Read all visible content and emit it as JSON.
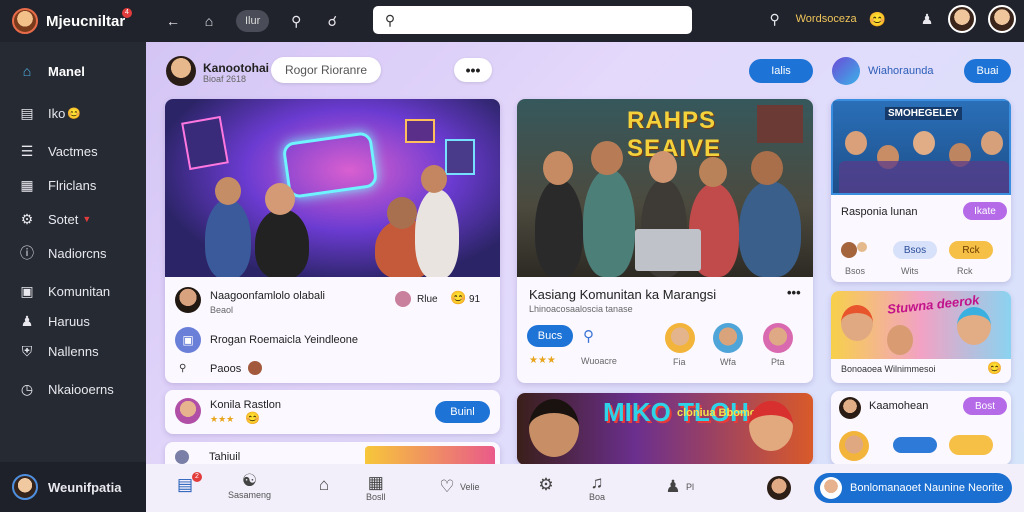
{
  "app": {
    "title": "Mjeucniltar",
    "notif_count": "4"
  },
  "nav": {
    "pill_label": "Ilur"
  },
  "search": {
    "placeholder": ""
  },
  "top_right": {
    "user_text": "Wordsoceza"
  },
  "sidebar": {
    "items": [
      {
        "label": "Manel",
        "icon": "home-icon"
      },
      {
        "label": "Iko",
        "icon": "briefcase-icon"
      },
      {
        "label": "Vactmes",
        "icon": "chart-icon"
      },
      {
        "label": "Flriclans",
        "icon": "grid-icon"
      },
      {
        "label": "Sotet",
        "icon": "settings-icon"
      },
      {
        "label": "Nadiorcns",
        "icon": "info-icon"
      },
      {
        "label": "Komunitan",
        "icon": "folder-icon"
      },
      {
        "label": "Haruus",
        "icon": "user-icon"
      },
      {
        "label": "Nallenns",
        "icon": "shield-icon"
      },
      {
        "label": "Nkaiooerns",
        "icon": "clock-icon"
      }
    ],
    "footer_label": "Weunifpatia"
  },
  "feed_header": {
    "name": "Kanootohai",
    "sub": "Bioaf 2618",
    "search_label": "Rogor Rioranre",
    "more_label": "•••",
    "right_button": "Ialis",
    "right_text": "Wiahoraunda",
    "right_button2": "Buai"
  },
  "card1": {
    "author": "Naagoonfamlolo olabali",
    "sub": "Beaol",
    "reaction_label": "Rlue",
    "reaction_count": "91",
    "line2": "Rrogan Roemaicla Yeindleone",
    "line3": "Paoos"
  },
  "card2": {
    "title": "Kasiang Komunitan ka Marangsi",
    "subtitle": "Lhinoacosaaloscia tanase",
    "banner_text": "RAHPS SEAIVE",
    "action_label": "Bucs",
    "rating": "★★★",
    "meta": "Wuoacre",
    "avatars": [
      "Fia",
      "Wfa",
      "Pta"
    ]
  },
  "card3": {
    "banner_text": "SMOHEGELEY",
    "title": "Rasponia lunan",
    "tag": "Ikate",
    "chips": [
      "Bsos",
      "Wits",
      "Rck"
    ]
  },
  "card4": {
    "banner_text": "Stuwna deerok",
    "caption": "Bonoaoea Wilnimmesoi"
  },
  "card5": {
    "name": "Konila Rastlon",
    "button": "Buinl",
    "rating": "★★★"
  },
  "card6": {
    "name": "Tahiuil"
  },
  "card7": {
    "banner_text": "MIKO TLOH",
    "banner_sub": "cloniua Bbomok"
  },
  "card8": {
    "name": "Kaamohean",
    "button": "Bost"
  },
  "bottombar": {
    "items": [
      {
        "label": "",
        "icon": "calendar-icon"
      },
      {
        "label": "Sasameng",
        "icon": "chat-icon"
      },
      {
        "label": "",
        "icon": "house-icon"
      },
      {
        "label": "Bosll",
        "icon": "grid-icon"
      },
      {
        "label": "Velie",
        "icon": "heart-icon"
      },
      {
        "label": "",
        "icon": "gear-icon"
      },
      {
        "label": "Boa",
        "icon": "bell-icon"
      },
      {
        "label": "Pl",
        "icon": "people-icon"
      }
    ],
    "cta_label": "Bonlomanaoet Naunine Neorite"
  },
  "colors": {
    "accent": "#1e73d6",
    "sidebar_bg": "#262a33",
    "topbar_bg": "#20232b",
    "tag_purple": "#b56be8"
  }
}
